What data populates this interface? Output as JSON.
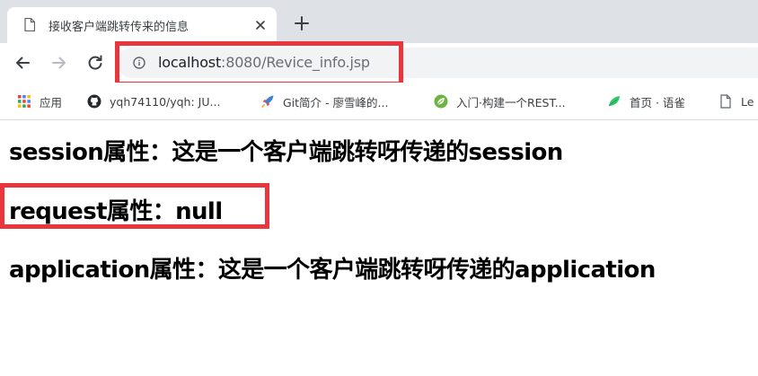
{
  "browser": {
    "tab": {
      "title": "接收客户端跳转传来的信息",
      "close_icon": "close-icon",
      "favicon": "page-icon"
    },
    "new_tab_icon": "plus-icon",
    "nav": {
      "back_icon": "arrow-left-icon",
      "forward_icon": "arrow-right-icon",
      "reload_icon": "reload-icon"
    },
    "address": {
      "host": "localhost",
      "rest": ":8080/Revice_info.jsp",
      "info_icon": "info-icon"
    },
    "bookmarks": [
      {
        "label": "应用",
        "icon": "apps-grid-icon"
      },
      {
        "label": "yqh74110/yqh: JU...",
        "icon": "github-icon"
      },
      {
        "label": "Git简介 - 廖雪峰的...",
        "icon": "rocket-icon"
      },
      {
        "label": "入门·构建一个REST...",
        "icon": "spring-leaf-icon"
      },
      {
        "label": "首页 · 语雀",
        "icon": "yuque-bird-icon"
      },
      {
        "label": "Le",
        "icon": "page-icon"
      }
    ]
  },
  "page": {
    "lines": [
      "session属性：这是一个客户端跳转呀传递的session",
      "request属性：null",
      "application属性：这是一个客户端跳转呀传递的application"
    ]
  },
  "colors": {
    "highlight": "#e8363c",
    "tabstrip": "#dee1e6",
    "omnibox": "#f1f3f4"
  }
}
